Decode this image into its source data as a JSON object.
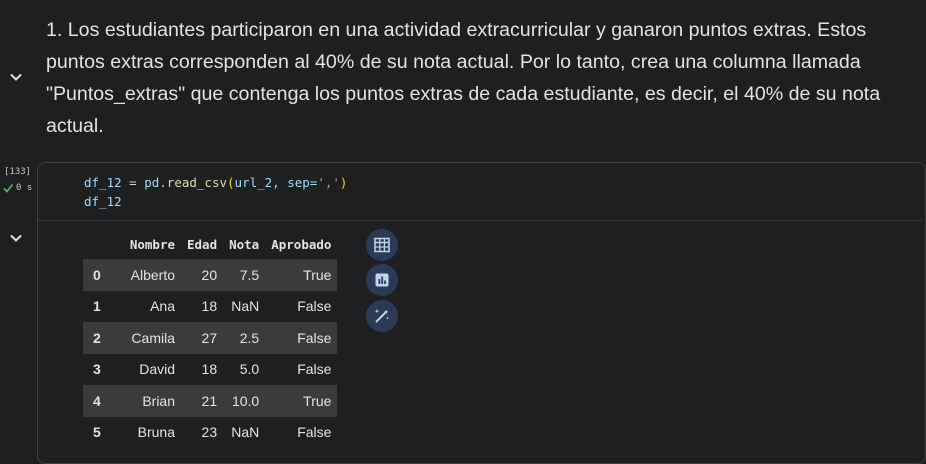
{
  "markdown_cell": {
    "text": "1. Los estudiantes participaron en una actividad extracurricular y ganaron puntos extras. Estos puntos extras corresponden al 40% de su nota actual. Por lo tanto, crea una columna llamada \"Puntos_extras\" que contenga los puntos extras de cada estudiante, es decir, el 40% de su nota actual."
  },
  "code_cell": {
    "execution_count": "[133]",
    "status_time": "0 s",
    "line1": {
      "var": "df_12",
      "eq": " = ",
      "obj": "pd.",
      "fn": "read_csv",
      "open": "(",
      "arg": "url_2, sep=",
      "str": "','",
      "close": ")"
    },
    "line2": "df_12"
  },
  "dataframe": {
    "columns": [
      "",
      "Nombre",
      "Edad",
      "Nota",
      "Aprobado"
    ],
    "rows": [
      [
        "0",
        "Alberto",
        "20",
        "7.5",
        "True"
      ],
      [
        "1",
        "Ana",
        "18",
        "NaN",
        "False"
      ],
      [
        "2",
        "Camila",
        "27",
        "2.5",
        "False"
      ],
      [
        "3",
        "David",
        "18",
        "5.0",
        "False"
      ],
      [
        "4",
        "Brian",
        "21",
        "10.0",
        "True"
      ],
      [
        "5",
        "Bruna",
        "23",
        "NaN",
        "False"
      ]
    ]
  },
  "toolbar_icons": [
    "table-icon",
    "chart-icon",
    "magic-wand-icon"
  ],
  "colors": {
    "background": "#1e1f20",
    "stripe": "#3a3b3d",
    "check": "#5bb974",
    "icon_button": "#2b3b55"
  }
}
